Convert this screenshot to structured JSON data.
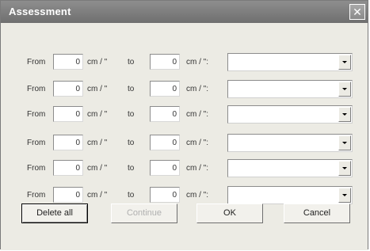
{
  "dialog": {
    "title": "Assessment",
    "close_glyph": "✕"
  },
  "rows": [
    {
      "from_label": "From",
      "from_value": "0",
      "unit1": "cm / \"",
      "to_label": "to",
      "to_value": "0",
      "unit2": "cm / \":",
      "select_value": ""
    },
    {
      "from_label": "From",
      "from_value": "0",
      "unit1": "cm / \"",
      "to_label": "to",
      "to_value": "0",
      "unit2": "cm / \":",
      "select_value": ""
    },
    {
      "from_label": "From",
      "from_value": "0",
      "unit1": "cm / \"",
      "to_label": "to",
      "to_value": "0",
      "unit2": "cm / \":",
      "select_value": ""
    },
    {
      "from_label": "From",
      "from_value": "0",
      "unit1": "cm / \"",
      "to_label": "to",
      "to_value": "0",
      "unit2": "cm / \":",
      "select_value": ""
    },
    {
      "from_label": "From",
      "from_value": "0",
      "unit1": "cm / \"",
      "to_label": "to",
      "to_value": "0",
      "unit2": "cm / \":",
      "select_value": ""
    },
    {
      "from_label": "From",
      "from_value": "0",
      "unit1": "cm / \"",
      "to_label": "to",
      "to_value": "0",
      "unit2": "cm / \":",
      "select_value": ""
    }
  ],
  "buttons": {
    "delete_all": "Delete all",
    "continue": "Continue",
    "ok": "OK",
    "cancel": "Cancel"
  }
}
